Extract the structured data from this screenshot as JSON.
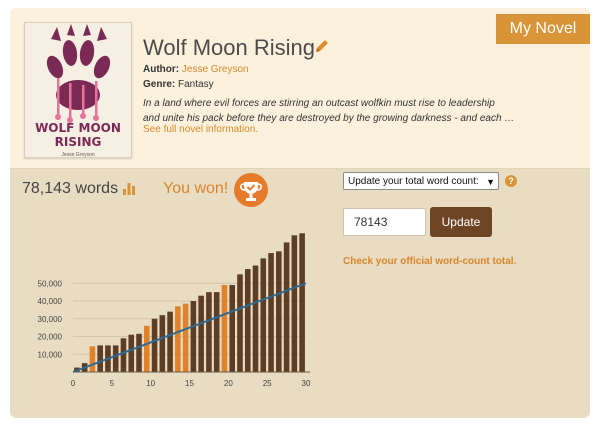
{
  "ribbon": {
    "label": "My Novel"
  },
  "novel": {
    "title": "Wolf Moon Rising",
    "author_label": "Author:",
    "author": "Jesse Greyson",
    "genre_label": "Genre:",
    "genre": "Fantasy",
    "synopsis_line1": "In a land where evil forces are stirring an outcast wolfkin must rise to leadership",
    "synopsis_line2": "and unite his pack before they are destroyed by the growing darkness - and each  …",
    "full_info_link": "See full novel information.",
    "cover": {
      "title_line1": "WOLF MOON",
      "title_line2": "RISING",
      "author": "Jesse Greyson"
    }
  },
  "stats": {
    "word_count_text": "78,143 words",
    "won_text": "You won!"
  },
  "controls": {
    "select_value": "Update your total word count:",
    "input_value": "78143",
    "update_button": "Update",
    "check_link": "Check your official word-count total."
  },
  "colors": {
    "bar_normal": "#5e3d25",
    "bar_highlight": "#e0822a",
    "par_line": "#2b6a95",
    "accent": "#d99438"
  },
  "chart_data": {
    "type": "bar",
    "x": [
      1,
      2,
      3,
      4,
      5,
      6,
      7,
      8,
      9,
      10,
      11,
      12,
      13,
      14,
      15,
      16,
      17,
      18,
      19,
      20,
      21,
      22,
      23,
      24,
      25,
      26,
      27,
      28,
      29,
      30
    ],
    "values": [
      2500,
      5000,
      14500,
      15000,
      15000,
      15000,
      19000,
      21000,
      21500,
      26000,
      30000,
      32000,
      34000,
      37000,
      38500,
      40000,
      43000,
      45000,
      45000,
      49000,
      49000,
      55000,
      58000,
      60000,
      64000,
      67000,
      68000,
      73000,
      77000,
      78143
    ],
    "highlighted_days": [
      3,
      10,
      14,
      15,
      20
    ],
    "par_line": {
      "from": [
        0,
        0
      ],
      "to": [
        30,
        50000
      ]
    },
    "xticks": [
      0,
      5,
      10,
      15,
      20,
      25,
      30
    ],
    "yticks": [
      10000,
      20000,
      30000,
      40000,
      50000
    ],
    "ytick_labels": [
      "10,000",
      "20,000",
      "30,000",
      "40,000",
      "50,000"
    ],
    "xlim": [
      0,
      30
    ],
    "ylim": [
      0,
      80000
    ],
    "grid": true
  }
}
